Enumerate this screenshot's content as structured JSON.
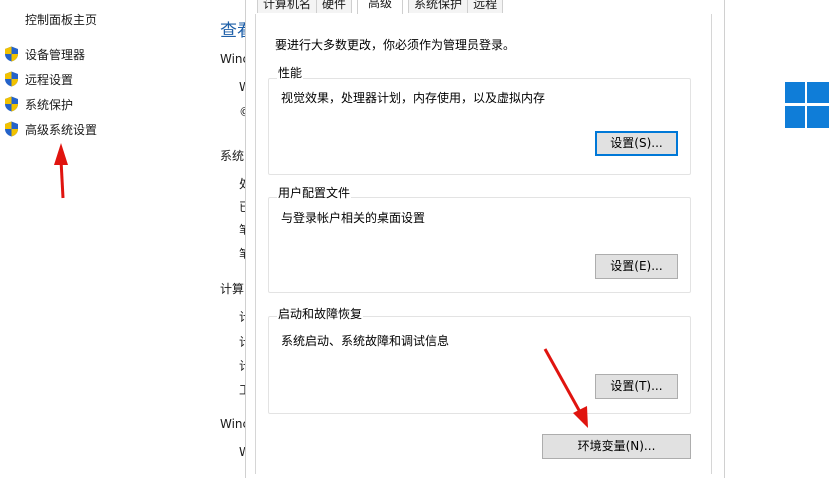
{
  "left_nav": {
    "home_link": "控制面板主页",
    "items": [
      {
        "label": "设备管理器"
      },
      {
        "label": "远程设置"
      },
      {
        "label": "系统保护"
      },
      {
        "label": "高级系统设置"
      }
    ]
  },
  "background": {
    "title_partial": "查看",
    "labels": [
      "Winc",
      "系统",
      "计算",
      "Winc"
    ],
    "fragments": [
      "W",
      "©",
      "处",
      "已",
      "笔",
      "笔",
      "计",
      "计",
      "计",
      "工",
      "W"
    ]
  },
  "dialog": {
    "tabs": [
      "计算机名",
      "硬件",
      "高级",
      "系统保护",
      "远程"
    ],
    "active_tab": "高级",
    "admin_note": "要进行大多数更改，你必须作为管理员登录。",
    "groups": [
      {
        "label": "性能",
        "description": "视觉效果，处理器计划，内存使用，以及虚拟内存",
        "button": "设置(S)..."
      },
      {
        "label": "用户配置文件",
        "description": "与登录帐户相关的桌面设置",
        "button": "设置(E)..."
      },
      {
        "label": "启动和故障恢复",
        "description": "系统启动、系统故障和调试信息",
        "button": "设置(T)..."
      }
    ],
    "env_button": "环境变量(N)..."
  },
  "colors": {
    "accent": "#0078d7",
    "arrow": "#e0140f",
    "windows_logo": "#0f7dd8",
    "shield_blue": "#2563c9",
    "shield_yellow": "#f2c200"
  }
}
